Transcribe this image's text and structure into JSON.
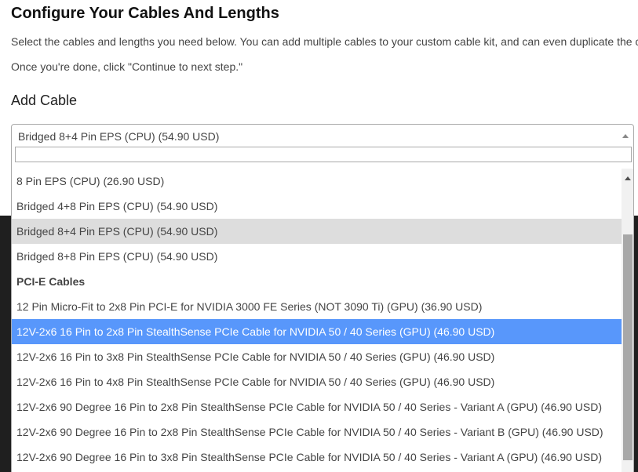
{
  "page": {
    "title": "Configure Your Cables And Lengths",
    "intro_line1": "Select the cables and lengths you need below. You can add multiple cables to your custom cable kit, and can even duplicate the c",
    "intro_line2": "Once you're done, click \"Continue to next step.\"",
    "section_title": "Add Cable"
  },
  "select": {
    "selected_value": "Bridged 8+4 Pin EPS (CPU) (54.90 USD)",
    "search_value": ""
  },
  "options": [
    {
      "label": "8 Pin EPS (CPU) (26.90 USD)",
      "state": "normal"
    },
    {
      "label": "Bridged 4+8 Pin EPS (CPU) (54.90 USD)",
      "state": "normal"
    },
    {
      "label": "Bridged 8+4 Pin EPS (CPU) (54.90 USD)",
      "state": "selected"
    },
    {
      "label": "Bridged 8+8 Pin EPS (CPU) (54.90 USD)",
      "state": "normal"
    },
    {
      "label": "PCI-E Cables",
      "state": "group"
    },
    {
      "label": "12 Pin Micro-Fit to 2x8 Pin PCI-E for NVIDIA 3000 FE Series (NOT 3090 Ti) (GPU) (36.90 USD)",
      "state": "normal"
    },
    {
      "label": "12V-2x6 16 Pin to 2x8 Pin StealthSense PCIe Cable for NVIDIA 50 / 40 Series (GPU) (46.90 USD)",
      "state": "highlighted"
    },
    {
      "label": "12V-2x6 16 Pin to 3x8 Pin StealthSense PCIe Cable for NVIDIA 50 / 40 Series (GPU) (46.90 USD)",
      "state": "normal"
    },
    {
      "label": "12V-2x6 16 Pin to 4x8 Pin StealthSense PCIe Cable for NVIDIA 50 / 40 Series (GPU) (46.90 USD)",
      "state": "normal"
    },
    {
      "label": "12V-2x6 90 Degree 16 Pin to 2x8 Pin StealthSense PCIe Cable for NVIDIA 50 / 40 Series - Variant A (GPU) (46.90 USD)",
      "state": "normal"
    },
    {
      "label": "12V-2x6 90 Degree 16 Pin to 2x8 Pin StealthSense PCIe Cable for NVIDIA 50 / 40 Series - Variant B (GPU) (46.90 USD)",
      "state": "normal"
    },
    {
      "label": "12V-2x6 90 Degree 16 Pin to 3x8 Pin StealthSense PCIe Cable for NVIDIA 50 / 40 Series - Variant A (GPU) (46.90 USD)",
      "state": "normal"
    }
  ],
  "icons": {
    "select_arrow": "chevron-up-icon",
    "scroll_up": "scroll-up-arrow-icon"
  },
  "colors": {
    "highlight": "#5897fb",
    "selected": "#dddddd",
    "backdrop": "#1f1f1f"
  }
}
